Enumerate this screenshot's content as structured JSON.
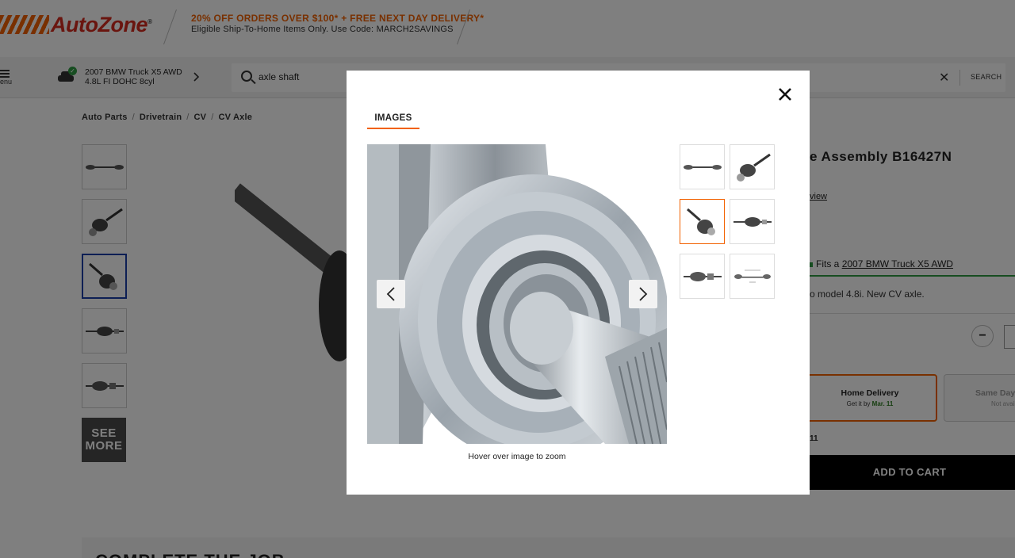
{
  "header": {
    "logo_text": "AutoZone",
    "promo_title": "20% OFF ORDERS OVER $100* + FREE NEXT DAY DELIVERY*",
    "promo_sub": "Eligible Ship-To-Home Items Only. Use Code: MARCH2SAVINGS"
  },
  "nav": {
    "menu_label": "enu",
    "vehicle_line1": "2007 BMW Truck X5 AWD",
    "vehicle_line2": "4.8L FI DOHC 8cyl",
    "search_value": "axle shaft",
    "search_label": "SEARCH"
  },
  "breadcrumb": [
    "Auto Parts",
    "Drivetrain",
    "CV",
    "CV Axle"
  ],
  "gallery": {
    "see_more_line1": "SEE",
    "see_more_line2": "MORE"
  },
  "product": {
    "title_fragment": "e Assembly B16427N",
    "review_fragment": "view",
    "fits_prefix": "Fits a",
    "fits_vehicle": "2007 BMW Truck X5 AWD",
    "note_fragment": "o model 4.8i. New CV axle.",
    "qty_minus": "−",
    "home_delivery_title": "Home Delivery",
    "home_delivery_prefix": "Get it by",
    "home_delivery_date": "Mar. 11",
    "same_day_title": "Same Day D",
    "same_day_sub": "Not avail",
    "date_fragment": "11",
    "add_to_cart": "ADD TO CART"
  },
  "section": {
    "complete_job": "COMPLETE THE JOB"
  },
  "modal": {
    "close_icon": "close-icon",
    "tab_label": "IMAGES",
    "zoom_hint": "Hover over image to zoom",
    "thumbnails": [
      "axle-full",
      "axle-boot",
      "axle-joint",
      "axle-side",
      "axle-inner",
      "axle-diagram"
    ],
    "active_thumbnail": 3
  },
  "colors": {
    "brand_orange": "#f26100",
    "brand_red": "#d52b1e",
    "fit_green": "#2f9b43",
    "active_blue": "#1a3ea8"
  }
}
